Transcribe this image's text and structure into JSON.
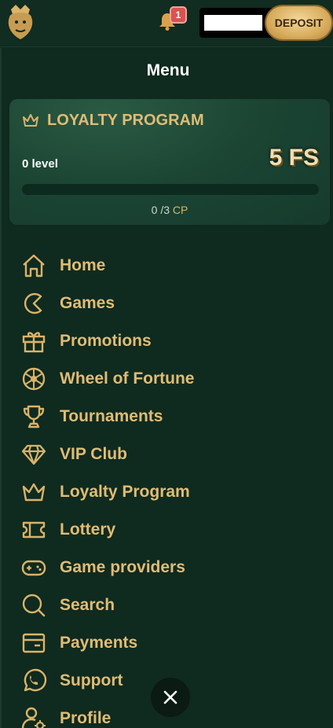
{
  "header": {
    "notification_count": "1",
    "deposit_label": "DEPOSIT"
  },
  "menu": {
    "title": "Menu"
  },
  "loyalty": {
    "title": "LOYALTY PROGRAM",
    "level": "0 level",
    "reward": "5 FS",
    "progress_current": "0",
    "progress_total": "/3",
    "progress_unit": "CP",
    "progress_fraction": 0
  },
  "nav": {
    "items": [
      {
        "label": "Home",
        "icon": "home-icon"
      },
      {
        "label": "Games",
        "icon": "games-icon"
      },
      {
        "label": "Promotions",
        "icon": "gift-icon"
      },
      {
        "label": "Wheel of Fortune",
        "icon": "wheel-icon"
      },
      {
        "label": "Tournaments",
        "icon": "trophy-icon"
      },
      {
        "label": "VIP Club",
        "icon": "diamond-icon"
      },
      {
        "label": "Loyalty Program",
        "icon": "crown-icon"
      },
      {
        "label": "Lottery",
        "icon": "ticket-icon"
      },
      {
        "label": "Game providers",
        "icon": "gamepad-icon"
      },
      {
        "label": "Search",
        "icon": "search-icon"
      },
      {
        "label": "Payments",
        "icon": "wallet-icon"
      },
      {
        "label": "Support",
        "icon": "whatsapp-icon"
      },
      {
        "label": "Profile",
        "icon": "profile-icon"
      }
    ]
  },
  "colors": {
    "background": "#0f2a1f",
    "accent_gold": "#d9b36a",
    "badge_red": "#d9534f"
  }
}
